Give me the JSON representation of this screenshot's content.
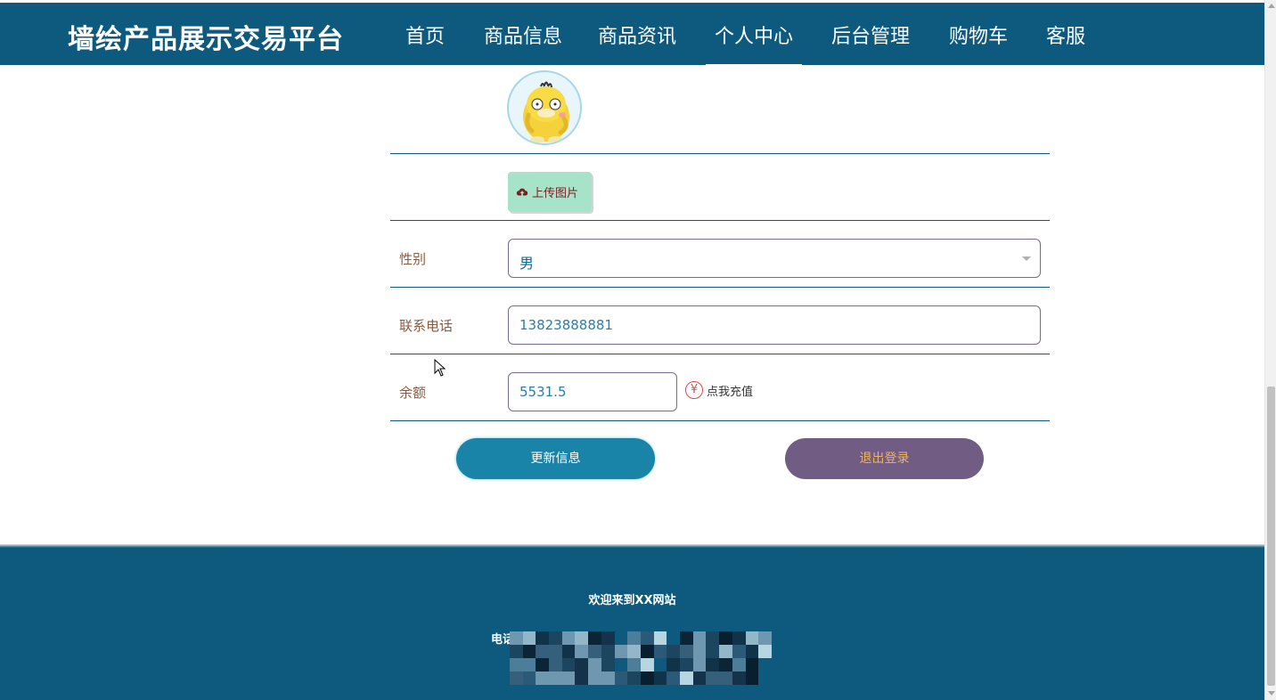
{
  "brand": "墙绘产品展示交易平台",
  "nav": [
    {
      "label": "首页",
      "active": false
    },
    {
      "label": "商品信息",
      "active": false
    },
    {
      "label": "商品资讯",
      "active": false
    },
    {
      "label": "个人中心",
      "active": true
    },
    {
      "label": "后台管理",
      "active": false
    },
    {
      "label": "购物车",
      "active": false
    },
    {
      "label": "客服",
      "active": false
    }
  ],
  "form": {
    "upload_label": "上传图片",
    "gender_label": "性别",
    "gender_value": "男",
    "phone_label": "联系电话",
    "phone_value": "13823888881",
    "balance_label": "余额",
    "balance_value": "5531.5",
    "recharge_symbol": "¥",
    "recharge_label": "点我充值",
    "update_button": "更新信息",
    "logout_button": "退出登录"
  },
  "footer": {
    "welcome": "欢迎来到XX网站",
    "contact_prefix": "电话"
  },
  "colors": {
    "primary": "#0d5a7e",
    "update_button": "#1a84a8",
    "logout_button": "#715d84",
    "logout_text": "#f2b25a",
    "upload_button": "#a6e3c8"
  }
}
